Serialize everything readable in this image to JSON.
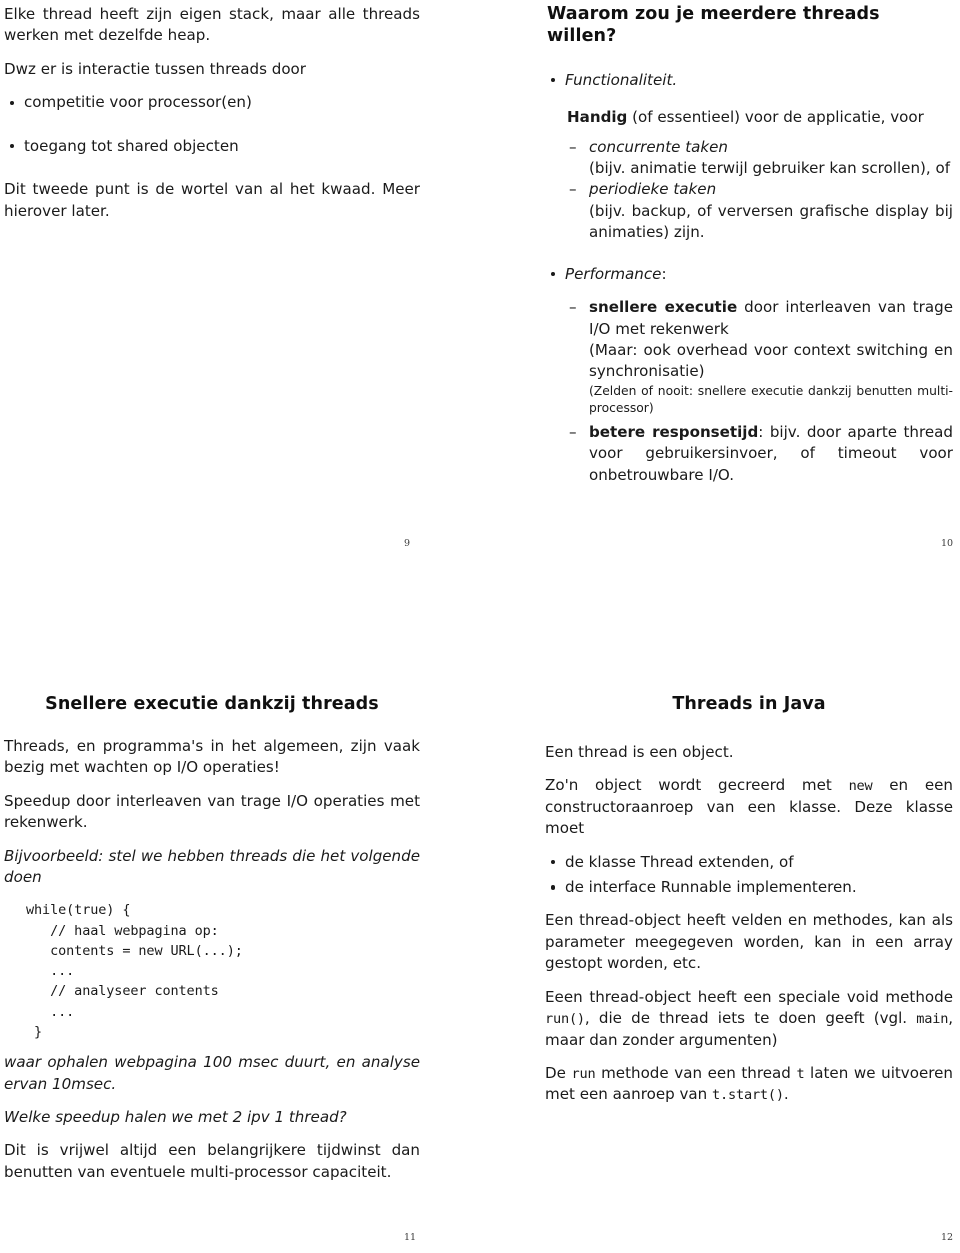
{
  "document": {
    "type": "lecture-handout",
    "language": "nl",
    "layout": "2x2-slides-per-page",
    "slide_count": 4
  },
  "slides": [
    {
      "number": "9",
      "title": "",
      "paragraphs": {
        "p1": "Elke thread heeft zijn eigen stack, maar alle threads werken met dezelfde heap.",
        "p2": "Dwz er is interactie tussen threads door",
        "p3": "Dit tweede punt is de wortel van al het kwaad. Meer hierover later."
      },
      "bullets": [
        "competitie voor processor(en)",
        "toegang tot shared objecten"
      ]
    },
    {
      "number": "10",
      "title": "Waarom zou je meerdere threads willen?",
      "bullet1": "Functionaliteit.",
      "handig_bold": "Handig",
      "handig_rest": " (of essentieel) voor de applicatie, voor",
      "sub1_italic": "concurrente taken",
      "sub1_detail": "(bijv. animatie terwijl gebruiker kan scrollen), of",
      "sub2_italic": "periodieke taken",
      "sub2_detail": "(bijv. backup, of verversen grafische display bij animaties) zijn.",
      "bullet2": "Performance",
      "bullet2_colon": ":",
      "perf1_bold": "snellere executie",
      "perf1_rest": " door interleaven van trage I/O met rekenwerk",
      "perf1_paren": "(Maar: ook overhead voor context switching en synchronisatie)",
      "perf1_small": "(Zelden of nooit: snellere executie dankzij benutten multi-processor)",
      "perf2_bold": "betere responsetijd",
      "perf2_rest": ": bijv. door aparte thread voor gebruikersinvoer, of timeout voor onbetrouwbare I/O."
    },
    {
      "number": "11",
      "title": "Snellere executie dankzij threads",
      "p1": "Threads, en programma's in het algemeen, zijn vaak bezig met wachten op I/O operaties!",
      "p2": "Speedup door interleaven van trage I/O operaties met rekenwerk.",
      "p3": "Bijvoorbeeld: stel we hebben threads die het volgende doen",
      "code": "while(true) {\n   // haal webpagina op:\n   contents = new URL(...);\n   ...\n   // analyseer contents\n   ...\n }",
      "p4": "waar ophalen webpagina 100 msec duurt, en analyse ervan 10msec.",
      "p5": "Welke speedup halen we met 2 ipv 1 thread?",
      "p6": "Dit is vrijwel altijd een belangrijkere tijdwinst dan benutten van eventuele multi-processor capaciteit."
    },
    {
      "number": "12",
      "title": "Threads in Java",
      "p1": "Een thread is een object.",
      "p2_a": "Zo'n object wordt gecreerd met ",
      "p2_code": "new",
      "p2_b": " en een constructoraanroep van een klasse. Deze klasse moet",
      "bullets": [
        "de klasse Thread extenden, of",
        "de interface Runnable implementeren."
      ],
      "p3": "Een thread-object heeft velden en methodes, kan als parameter meegegeven worden, kan in een array gestopt worden, etc.",
      "p4_a": "Eeen thread-object heeft een speciale void methode ",
      "p4_code1": "run()",
      "p4_b": ", die de thread iets te doen geeft (vgl. ",
      "p4_code2": "main",
      "p4_c": ", maar dan zonder argumenten)",
      "p5_a": "De ",
      "p5_code1": "run",
      "p5_b": " methode van een thread ",
      "p5_code2": "t",
      "p5_c": " laten we uitvoeren met een aanroep van ",
      "p5_code3": "t.start()",
      "p5_d": "."
    }
  ]
}
